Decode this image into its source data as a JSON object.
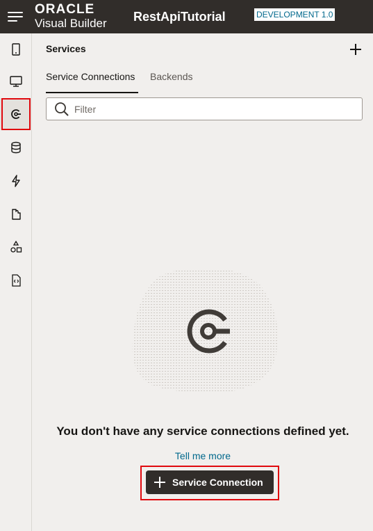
{
  "header": {
    "brand_line1": "ORACLE",
    "brand_line2": "Visual Builder",
    "app_title": "RestApiTutorial",
    "environment": "DEVELOPMENT   1.0"
  },
  "rail": {
    "items": [
      {
        "icon": "mobile-icon"
      },
      {
        "icon": "desktop-icon"
      },
      {
        "icon": "service-connection-icon",
        "active": true
      },
      {
        "icon": "database-icon"
      },
      {
        "icon": "lightning-icon"
      },
      {
        "icon": "component-icon"
      },
      {
        "icon": "shapes-icon"
      },
      {
        "icon": "source-file-icon"
      }
    ]
  },
  "panel": {
    "title": "Services",
    "tabs": [
      {
        "label": "Service Connections",
        "active": true
      },
      {
        "label": "Backends",
        "active": false
      }
    ],
    "filter_placeholder": "Filter",
    "empty_message": "You don't have any service connections defined yet.",
    "tell_me_more": "Tell me more",
    "add_button_label": "Service Connection"
  },
  "colors": {
    "header_bg": "#312d2a",
    "accent_link": "#00688c",
    "highlight": "#e0080d",
    "panel_bg": "#f1efed"
  }
}
